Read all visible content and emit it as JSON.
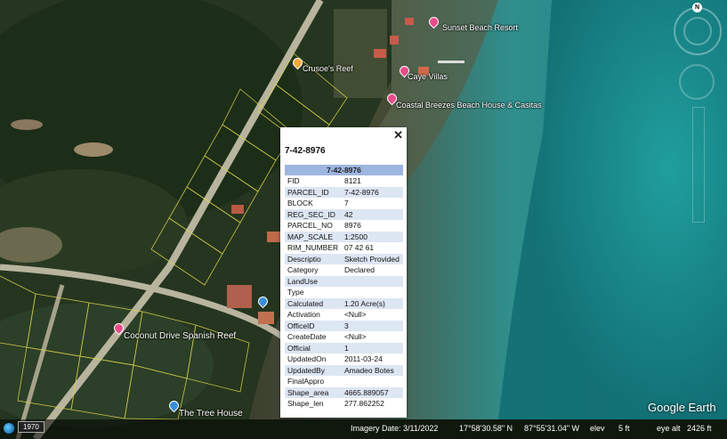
{
  "places": [
    {
      "name": "Sunset Beach Resort",
      "color": "#e94b8a"
    },
    {
      "name": "Caye Villas",
      "color": "#e94b8a"
    },
    {
      "name": "Coastal Breezes Beach House & Casitas",
      "color": "#e94b8a"
    },
    {
      "name": "Coconut Drive Spanish Reef",
      "color": "#e94b8a"
    },
    {
      "name": "The Tree House",
      "color": "#3a8fd9"
    },
    {
      "name": "Crusoe's Reef",
      "color": "#f2a93b"
    }
  ],
  "balloon": {
    "title": "7-42-8976",
    "table_header": "7-42-8976",
    "close_icon": "close-icon",
    "rows": [
      {
        "key": "FID",
        "value": "8121"
      },
      {
        "key": "PARCEL_ID",
        "value": "7-42-8976"
      },
      {
        "key": "BLOCK",
        "value": "7"
      },
      {
        "key": "REG_SEC_ID",
        "value": "42"
      },
      {
        "key": "PARCEL_NO",
        "value": "8976"
      },
      {
        "key": "MAP_SCALE",
        "value": "1:2500"
      },
      {
        "key": "RIM_NUMBER",
        "value": "07 42 61"
      },
      {
        "key": "Descriptio",
        "value": "Sketch Provided"
      },
      {
        "key": "Category",
        "value": "Declared"
      },
      {
        "key": "LandUse",
        "value": ""
      },
      {
        "key": "Type",
        "value": ""
      },
      {
        "key": "Calculated",
        "value": "1.20 Acre(s)"
      },
      {
        "key": "Activation",
        "value": "<Null>"
      },
      {
        "key": "OfficeID",
        "value": "3"
      },
      {
        "key": "CreateDate",
        "value": "<Null>"
      },
      {
        "key": "Official",
        "value": "1"
      },
      {
        "key": "UpdatedOn",
        "value": "2011-03-24"
      },
      {
        "key": "UpdatedBy",
        "value": "Amadeo Botes"
      },
      {
        "key": "FinalAppro",
        "value": ""
      },
      {
        "key": "Shape_area",
        "value": "4665.889057"
      },
      {
        "key": "Shape_len",
        "value": "277.862252"
      }
    ]
  },
  "nav": {
    "north": "N"
  },
  "status": {
    "year": "1970",
    "imagery_date": "Imagery Date: 3/11/2022",
    "lat": "17°58'30.58\" N",
    "lon": "87°55'31.04\" W",
    "elev_label": "elev",
    "elev_value": "5 ft",
    "eye_alt_label": "eye alt",
    "eye_alt_value": "2426 ft"
  },
  "watermark": "Google Earth"
}
